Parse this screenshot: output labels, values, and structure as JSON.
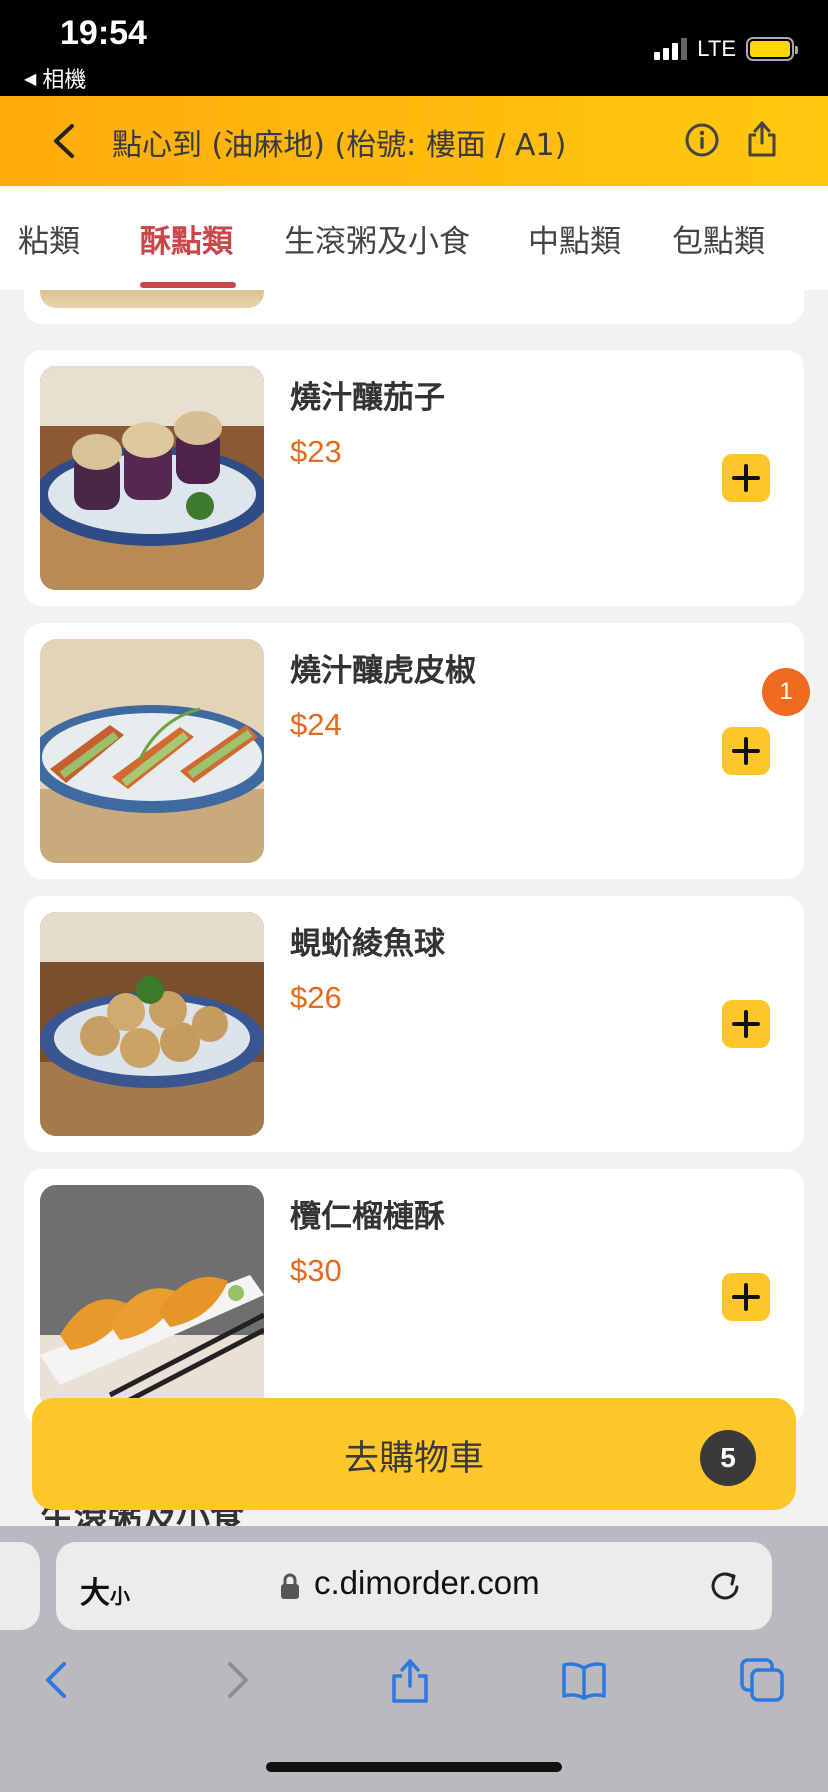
{
  "status_bar": {
    "time": "19:54",
    "back_label": "相機",
    "network": "LTE"
  },
  "header": {
    "title": "點心到 (油麻地) (枱號: 樓面 / A1)"
  },
  "tabs": [
    {
      "label": "粘類",
      "active": false
    },
    {
      "label": "酥點類",
      "active": true
    },
    {
      "label": "生滾粥及小食",
      "active": false
    },
    {
      "label": "中點類",
      "active": false
    },
    {
      "label": "包點類",
      "active": false
    }
  ],
  "menu_items": [
    {
      "name": "燒汁釀茄子",
      "price": "$23",
      "quantity": null
    },
    {
      "name": "燒汁釀虎皮椒",
      "price": "$24",
      "quantity": "1"
    },
    {
      "name": "蜆蚧綾魚球",
      "price": "$26",
      "quantity": null
    },
    {
      "name": "欖仁榴槤酥",
      "price": "$30",
      "quantity": null
    }
  ],
  "next_section_title": "生滾粥及小食",
  "cart": {
    "label": "去購物車",
    "count": "5"
  },
  "browser": {
    "text_size_label": "大",
    "text_size_small": "小",
    "url": "c.dimorder.com"
  },
  "colors": {
    "accent": "#ffc629",
    "header_start": "#ffab0a",
    "active_tab": "#c9484b",
    "price": "#e46a1c",
    "badge": "#ee6a1f"
  }
}
